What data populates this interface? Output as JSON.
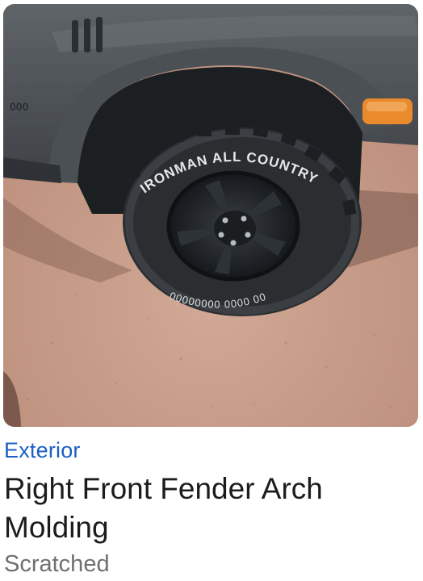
{
  "card": {
    "image_alt": "Photo of right front wheel and fender of a dark gray SUV on red dirt",
    "category": "Exterior",
    "title": "Right Front Fender Arch Molding",
    "status": "Scratched"
  },
  "colors": {
    "category_link": "#1a5fc4",
    "title_text": "#1c1c1c",
    "status_text": "#6f6f6f"
  }
}
